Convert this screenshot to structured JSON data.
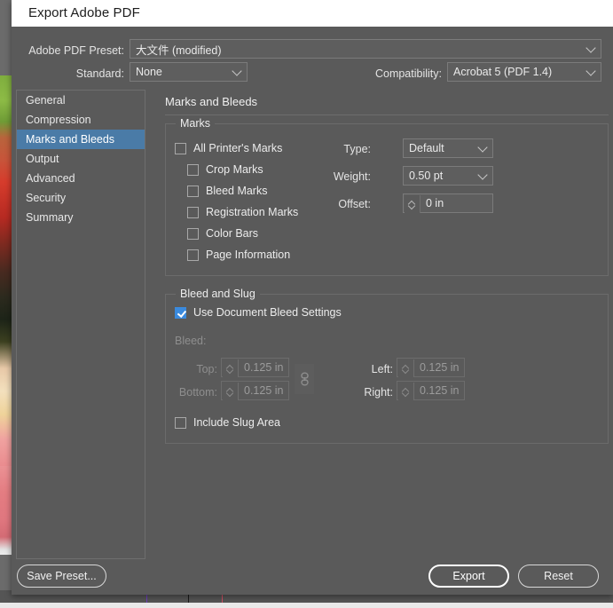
{
  "window": {
    "title": "Export Adobe PDF"
  },
  "top": {
    "preset_label": "Adobe PDF Preset:",
    "preset_value": "大文件 (modified)",
    "standard_label": "Standard:",
    "standard_value": "None",
    "compatibility_label": "Compatibility:",
    "compatibility_value": "Acrobat 5 (PDF 1.4)"
  },
  "sidebar": {
    "items": [
      {
        "label": "General",
        "active": false
      },
      {
        "label": "Compression",
        "active": false
      },
      {
        "label": "Marks and Bleeds",
        "active": true
      },
      {
        "label": "Output",
        "active": false
      },
      {
        "label": "Advanced",
        "active": false
      },
      {
        "label": "Security",
        "active": false
      },
      {
        "label": "Summary",
        "active": false
      }
    ]
  },
  "panel": {
    "title": "Marks and Bleeds",
    "marks": {
      "legend": "Marks",
      "all_printers_marks": {
        "label": "All Printer's Marks",
        "checked": false
      },
      "items": [
        {
          "label": "Crop Marks",
          "checked": false
        },
        {
          "label": "Bleed Marks",
          "checked": false
        },
        {
          "label": "Registration Marks",
          "checked": false
        },
        {
          "label": "Color Bars",
          "checked": false
        },
        {
          "label": "Page Information",
          "checked": false
        }
      ],
      "type_label": "Type:",
      "type_value": "Default",
      "weight_label": "Weight:",
      "weight_value": "0.50 pt",
      "offset_label": "Offset:",
      "offset_value": "0 in"
    },
    "bleed_and_slug": {
      "legend": "Bleed and Slug",
      "use_document_bleed": {
        "label": "Use Document Bleed Settings",
        "checked": true
      },
      "bleed_label": "Bleed:",
      "top_label": "Top:",
      "top_value": "0.125 in",
      "bottom_label": "Bottom:",
      "bottom_value": "0.125 in",
      "left_label": "Left:",
      "left_value": "0.125 in",
      "right_label": "Right:",
      "right_value": "0.125 in",
      "link_icon": "chain-link-icon",
      "include_slug": {
        "label": "Include Slug Area",
        "checked": false
      }
    }
  },
  "footer": {
    "save_preset": "Save Preset...",
    "export": "Export",
    "reset": "Reset"
  },
  "colors": {
    "dialog_bg": "#5a5a5a",
    "accent_selection": "#4a7ba7",
    "checkbox_checked": "#3a8ade",
    "titlebar_bg": "#ffffff"
  }
}
